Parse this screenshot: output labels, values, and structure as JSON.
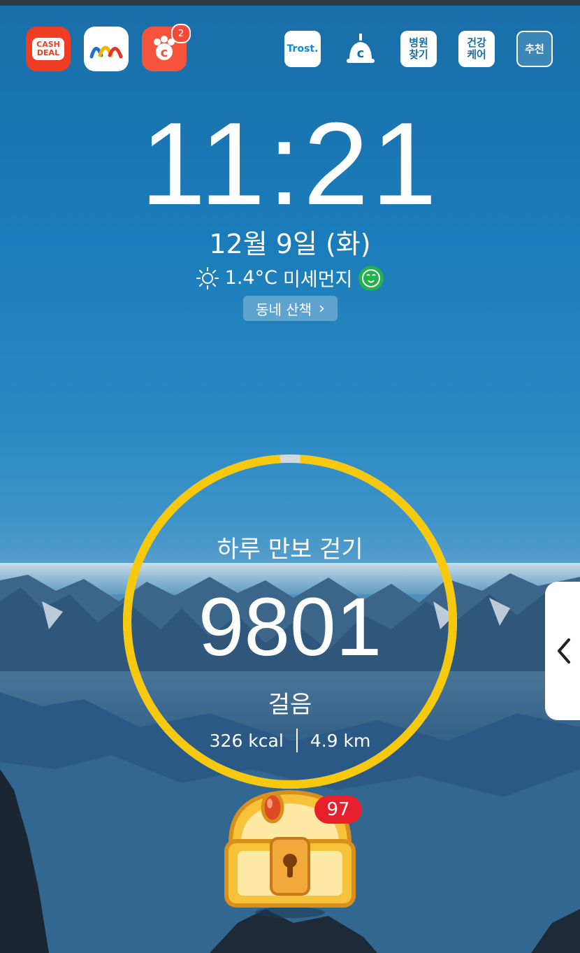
{
  "status_bar": {},
  "apps_left": [
    {
      "name": "cashdeal",
      "label_line1": "CASH",
      "label_line2": "DEAL",
      "bg": "#ef3d24"
    },
    {
      "name": "wave-app",
      "bg": "#ffffff"
    },
    {
      "name": "cashwalk-c",
      "badge": "2",
      "bg": "#f4553a"
    }
  ],
  "apps_right": [
    {
      "name": "trost",
      "label": "Trost.",
      "bg": "#ffffff",
      "fg": "#0f8ad6"
    },
    {
      "name": "c-bell",
      "bg": "transparent"
    },
    {
      "name": "hospital",
      "label_line1": "병원",
      "label_line2": "찾기",
      "bg": "#ffffff",
      "fg": "#1d6da6"
    },
    {
      "name": "health",
      "label_line1": "건강",
      "label_line2": "케어",
      "bg": "#ffffff",
      "fg": "#1d6da6"
    },
    {
      "name": "recommend",
      "label": "추천",
      "bg": "rgba(255,255,255,0.18)",
      "fg": "#ffffff"
    }
  ],
  "clock": {
    "time": "11:21",
    "date": "12월 9일 (화)"
  },
  "weather": {
    "temp": "1.4°C",
    "dust_label": "미세먼지",
    "icon": "sun-icon",
    "dust_color": "#22b14c"
  },
  "walk_button": {
    "label": "동네 산책"
  },
  "pedometer": {
    "title": "하루 만보 걷기",
    "steps": "9801",
    "unit": "걸음",
    "kcal": "326 kcal",
    "distance": "4.9 km",
    "goal_progress": 0.98,
    "ring_color": "#f7c90e"
  },
  "reward": {
    "badge": "97"
  }
}
